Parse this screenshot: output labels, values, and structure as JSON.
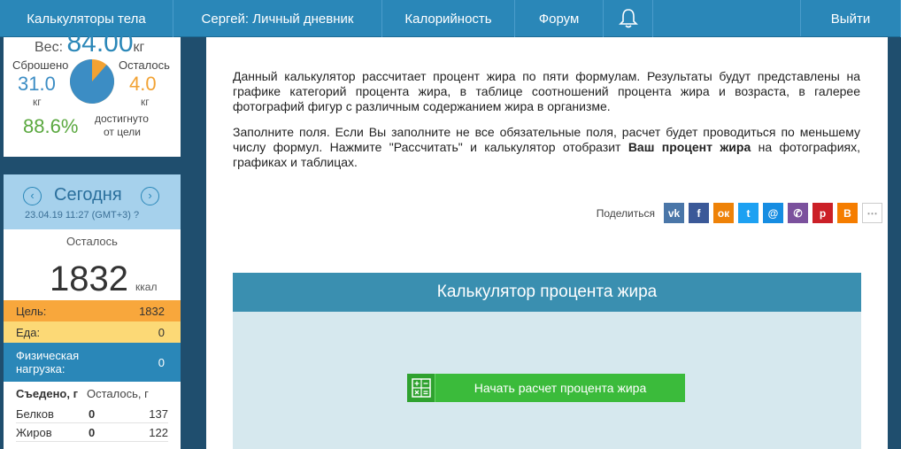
{
  "nav": {
    "items": [
      "Калькуляторы тела",
      "Сергей: Личный дневник",
      "Калорийность",
      "Форум"
    ],
    "logout": "Выйти",
    "bell_icon": "bell-icon"
  },
  "weight": {
    "label": "Вес:",
    "value": "84.00",
    "unit": "кг",
    "lost_label": "Сброшено",
    "lost_value": "31.0",
    "lost_unit": "кг",
    "left_label": "Осталось",
    "left_value": "4.0",
    "left_unit": "кг",
    "percent": "88.6%",
    "percent_label_1": "достигнуто",
    "percent_label_2": "от цели",
    "progress_fraction": 0.886,
    "colors": {
      "done": "#3c8dc4",
      "left": "#f2a233"
    }
  },
  "today": {
    "title": "Сегодня",
    "prev": "‹",
    "next": "›",
    "date": "23.04.19 11:27 (GMT+3)",
    "help": "?",
    "remain_label": "Осталось",
    "kcal": "1832",
    "kcal_unit": "ккал",
    "goal_label": "Цель:",
    "goal_value": "1832",
    "food_label": "Еда:",
    "food_value": "0",
    "phys_label_1": "Физическая",
    "phys_label_2": "нагрузка:",
    "phys_value": "0",
    "eaten_head": "Съедено, г",
    "remain_head": "Осталось, г",
    "nutrients": [
      {
        "name": "Белков",
        "eaten": "0",
        "remain": "137"
      },
      {
        "name": "Жиров",
        "eaten": "0",
        "remain": "122"
      }
    ]
  },
  "main": {
    "intro_1": "Данный калькулятор рассчитает процент жира по пяти формулам. Результаты будут представлены на графике категорий процента жира, в таблице соотношений процента жира и возраста, в галерее фотографий фигур с различным содержанием жира в организме.",
    "intro_2_a": "Заполните поля. Если Вы заполните не все обязательные поля, расчет будет проводиться по меньшему числу формул. Нажмите \"Рассчитать\" и калькулятор отобразит ",
    "intro_2_b": "Ваш процент жира",
    "intro_2_c": " на фотографиях, графиках и таблицах.",
    "share_label": "Поделиться",
    "share": [
      {
        "id": "vk",
        "glyph": "vk",
        "color": "#4a76a8"
      },
      {
        "id": "facebook",
        "glyph": "f",
        "color": "#3b5998"
      },
      {
        "id": "odnoklassniki",
        "glyph": "ок",
        "color": "#ee8208"
      },
      {
        "id": "twitter",
        "glyph": "t",
        "color": "#1da1f2"
      },
      {
        "id": "moimir",
        "glyph": "@",
        "color": "#168de2"
      },
      {
        "id": "viber",
        "glyph": "✆",
        "color": "#7b519d"
      },
      {
        "id": "pinterest",
        "glyph": "p",
        "color": "#cb2027"
      },
      {
        "id": "blogger",
        "glyph": "B",
        "color": "#f57d00"
      }
    ],
    "share_more": "⋯",
    "calc_title": "Калькулятор процента жира",
    "calc_button": "Начать расчет процента жира"
  }
}
